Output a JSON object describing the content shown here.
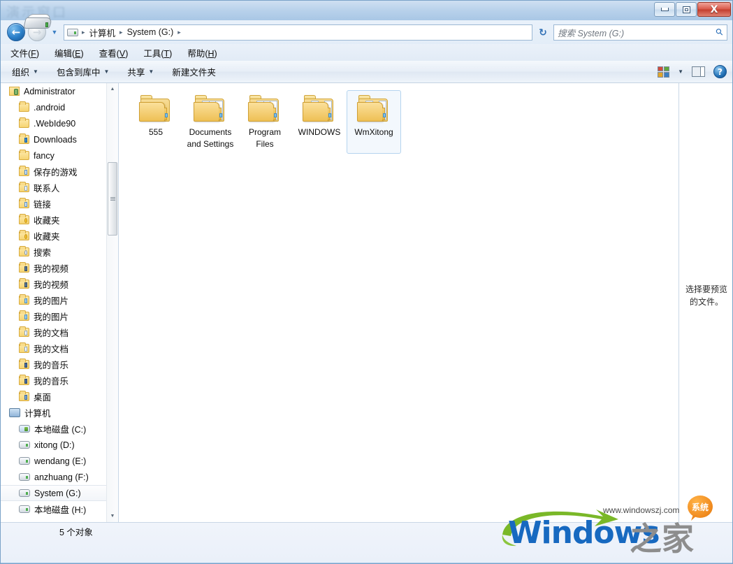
{
  "window": {
    "title": "演示窗口",
    "controls": {
      "minimize": "最小化",
      "maximize": "最大化",
      "close": "X"
    }
  },
  "navigation": {
    "back_label": "←",
    "forward_label": "→",
    "history_caret": "▼",
    "refresh_label": "↻",
    "breadcrumb": [
      "计算机",
      "System (G:)"
    ],
    "breadcrumb_separator": "▸",
    "breadcrumb_end_chevron": "▸"
  },
  "search": {
    "placeholder": "搜索 System (G:)",
    "icon": "search-icon"
  },
  "menubar": {
    "items": [
      {
        "text": "文件",
        "accel": "F"
      },
      {
        "text": "编辑",
        "accel": "E"
      },
      {
        "text": "查看",
        "accel": "V"
      },
      {
        "text": "工具",
        "accel": "T"
      },
      {
        "text": "帮助",
        "accel": "H"
      }
    ]
  },
  "toolbar": {
    "organize": "组织",
    "include_library": "包含到库中",
    "share": "共享",
    "new_folder": "新建文件夹",
    "caret": "▼",
    "help_glyph": "?"
  },
  "sidebar": {
    "items": [
      {
        "label": "Administrator",
        "icon": "user-folder-icon",
        "level": 0,
        "selected": false
      },
      {
        "label": ".android",
        "icon": "folder-icon",
        "level": 1,
        "selected": false
      },
      {
        "label": ".WebIde90",
        "icon": "folder-icon",
        "level": 1,
        "selected": false
      },
      {
        "label": "Downloads",
        "icon": "downloads-folder-icon",
        "level": 1,
        "selected": false
      },
      {
        "label": "fancy",
        "icon": "folder-icon",
        "level": 1,
        "selected": false
      },
      {
        "label": "保存的游戏",
        "icon": "saved-games-folder-icon",
        "level": 1,
        "selected": false
      },
      {
        "label": "联系人",
        "icon": "contacts-folder-icon",
        "level": 1,
        "selected": false
      },
      {
        "label": "链接",
        "icon": "links-folder-icon",
        "level": 1,
        "selected": false
      },
      {
        "label": "收藏夹",
        "icon": "favorites-folder-icon",
        "level": 1,
        "selected": false
      },
      {
        "label": "收藏夹",
        "icon": "favorites-folder-icon",
        "level": 1,
        "selected": false
      },
      {
        "label": "搜索",
        "icon": "searches-folder-icon",
        "level": 1,
        "selected": false
      },
      {
        "label": "我的视频",
        "icon": "videos-folder-icon",
        "level": 1,
        "selected": false
      },
      {
        "label": "我的视频",
        "icon": "videos-folder-icon",
        "level": 1,
        "selected": false
      },
      {
        "label": "我的图片",
        "icon": "pictures-folder-icon",
        "level": 1,
        "selected": false
      },
      {
        "label": "我的图片",
        "icon": "pictures-folder-icon",
        "level": 1,
        "selected": false
      },
      {
        "label": "我的文档",
        "icon": "documents-folder-icon",
        "level": 1,
        "selected": false
      },
      {
        "label": "我的文档",
        "icon": "documents-folder-icon",
        "level": 1,
        "selected": false
      },
      {
        "label": "我的音乐",
        "icon": "music-folder-icon",
        "level": 1,
        "selected": false
      },
      {
        "label": "我的音乐",
        "icon": "music-folder-icon",
        "level": 1,
        "selected": false
      },
      {
        "label": "桌面",
        "icon": "desktop-folder-icon",
        "level": 1,
        "selected": false
      },
      {
        "label": "计算机",
        "icon": "computer-icon",
        "level": 0,
        "selected": false
      },
      {
        "label": "本地磁盘 (C:)",
        "icon": "system-drive-icon",
        "level": 1,
        "selected": false
      },
      {
        "label": "xitong (D:)",
        "icon": "drive-icon",
        "level": 1,
        "selected": false
      },
      {
        "label": "wendang (E:)",
        "icon": "drive-icon",
        "level": 1,
        "selected": false
      },
      {
        "label": "anzhuang (F:)",
        "icon": "drive-icon",
        "level": 1,
        "selected": false
      },
      {
        "label": "System (G:)",
        "icon": "drive-icon",
        "level": 1,
        "selected": true
      },
      {
        "label": "本地磁盘 (H:)",
        "icon": "drive-icon",
        "level": 1,
        "selected": false
      }
    ],
    "scroll_up": "▲",
    "scroll_down": "▼"
  },
  "files": {
    "items": [
      {
        "name": "555",
        "icon": "folder-empty-icon",
        "selected": false
      },
      {
        "name": "Documents and Settings",
        "icon": "folder-full-icon",
        "selected": false
      },
      {
        "name": "Program Files",
        "icon": "folder-full-icon",
        "selected": false
      },
      {
        "name": "WINDOWS",
        "icon": "folder-docs-icon",
        "selected": false
      },
      {
        "name": "WmXitong",
        "icon": "folder-docs-icon",
        "selected": true
      }
    ]
  },
  "preview_pane": {
    "text": "选择要预览的文件。"
  },
  "statusbar": {
    "text": "5 个对象",
    "icon": "drive-icon"
  },
  "watermark": {
    "url": "www.windowszj.com",
    "brand_en": "Windows",
    "brand_cn": "之家",
    "badge": "系统"
  },
  "colors": {
    "titlebar": "#a9c7e5",
    "accent_blue": "#1769c0",
    "close_red": "#c33e2e",
    "selection_border": "#b5d4ef",
    "folder_yellow": "#eec055",
    "watermark_green": "#7ab828",
    "badge_orange": "#f08a1e"
  }
}
